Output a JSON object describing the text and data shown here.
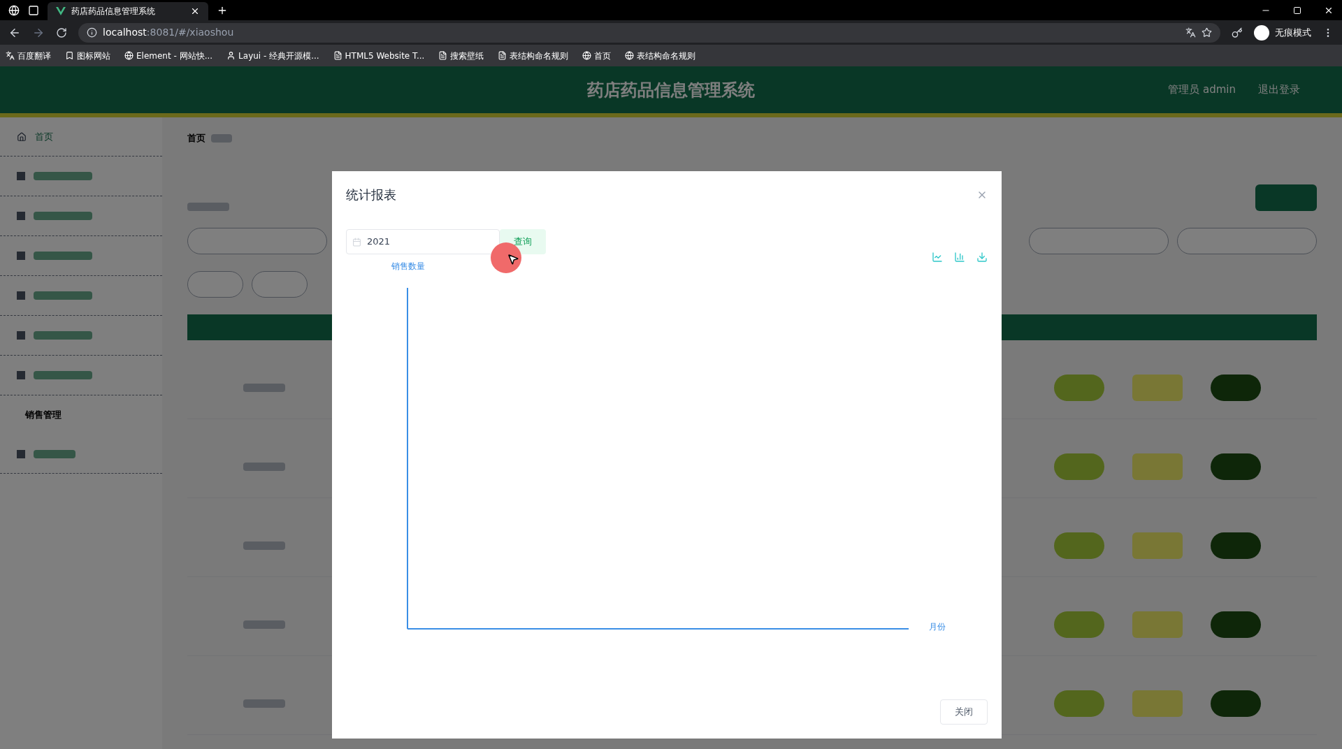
{
  "browser": {
    "tab_title": "药店药品信息管理系统",
    "url_host": "localhost",
    "url_rest": ":8081/#/xiaoshou",
    "profile": "无痕模式",
    "bookmarks": [
      "百度翻译",
      "图标网站",
      "Element - 网站快...",
      "Layui - 经典开源模...",
      "HTML5 Website T...",
      "搜索壁纸",
      "表结构命名规则",
      "首页",
      "表结构命名规则"
    ]
  },
  "header": {
    "title": "药店药品信息管理系统",
    "user": "管理员 admin",
    "logout": "退出登录"
  },
  "sidebar": {
    "home": "首页",
    "sub_item": "销售管理"
  },
  "breadcrumb": "首页",
  "modal": {
    "title": "统计报表",
    "date_value": "2021",
    "query_button": "查询",
    "y_name": "销售数量",
    "x_name": "月份",
    "close_button": "关闭"
  }
}
